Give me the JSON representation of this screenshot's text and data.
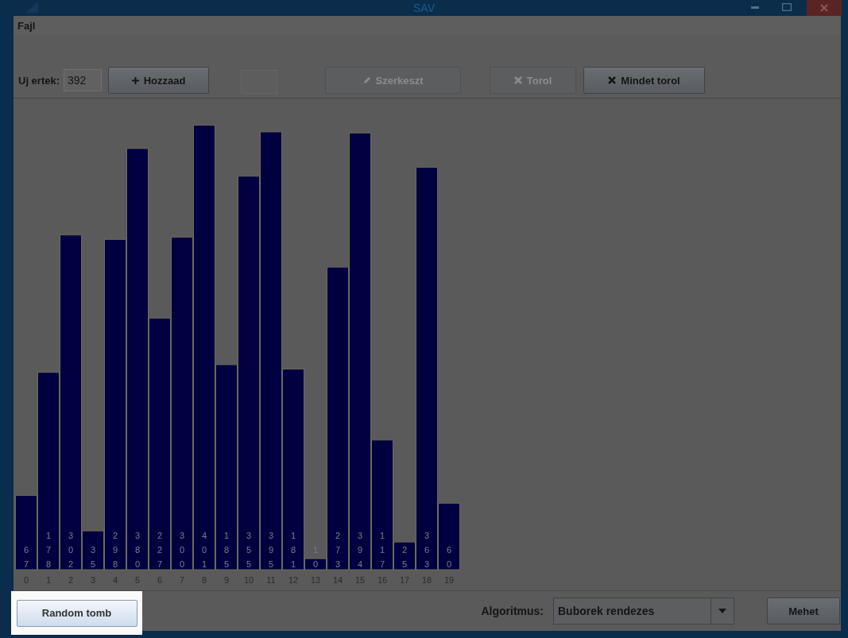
{
  "window": {
    "title": "SAV"
  },
  "menu": [
    "Fajl"
  ],
  "toolbar": {
    "new_value_label": "Uj ertek:",
    "new_value": "392",
    "buttons": [
      {
        "kind": "add",
        "label": "Hozzaad",
        "disabled": false
      },
      {
        "kind": "edit",
        "label": "Szerkeszt",
        "disabled": true
      },
      {
        "kind": "delete",
        "label": "Torol",
        "disabled": true
      },
      {
        "kind": "delete_all",
        "label": "Mindet torol",
        "disabled": false
      }
    ]
  },
  "chart": {
    "chart_data": {
      "type": "bar",
      "categories": [
        "0",
        "1",
        "2",
        "3",
        "4",
        "5",
        "6",
        "7",
        "8",
        "9",
        "10",
        "11",
        "12",
        "13",
        "14",
        "15",
        "16",
        "17",
        "18",
        "19"
      ],
      "values": [
        67,
        178,
        302,
        35,
        298,
        380,
        227,
        300,
        401,
        185,
        355,
        395,
        181,
        10,
        273,
        394,
        117,
        25,
        363,
        60
      ],
      "data_labels": true
    }
  },
  "bottom": {
    "random_button": "Random tomb",
    "algorithm_label": "Algoritmus:",
    "algorithm": "Buborek rendezes",
    "go_button": "Mehet"
  }
}
